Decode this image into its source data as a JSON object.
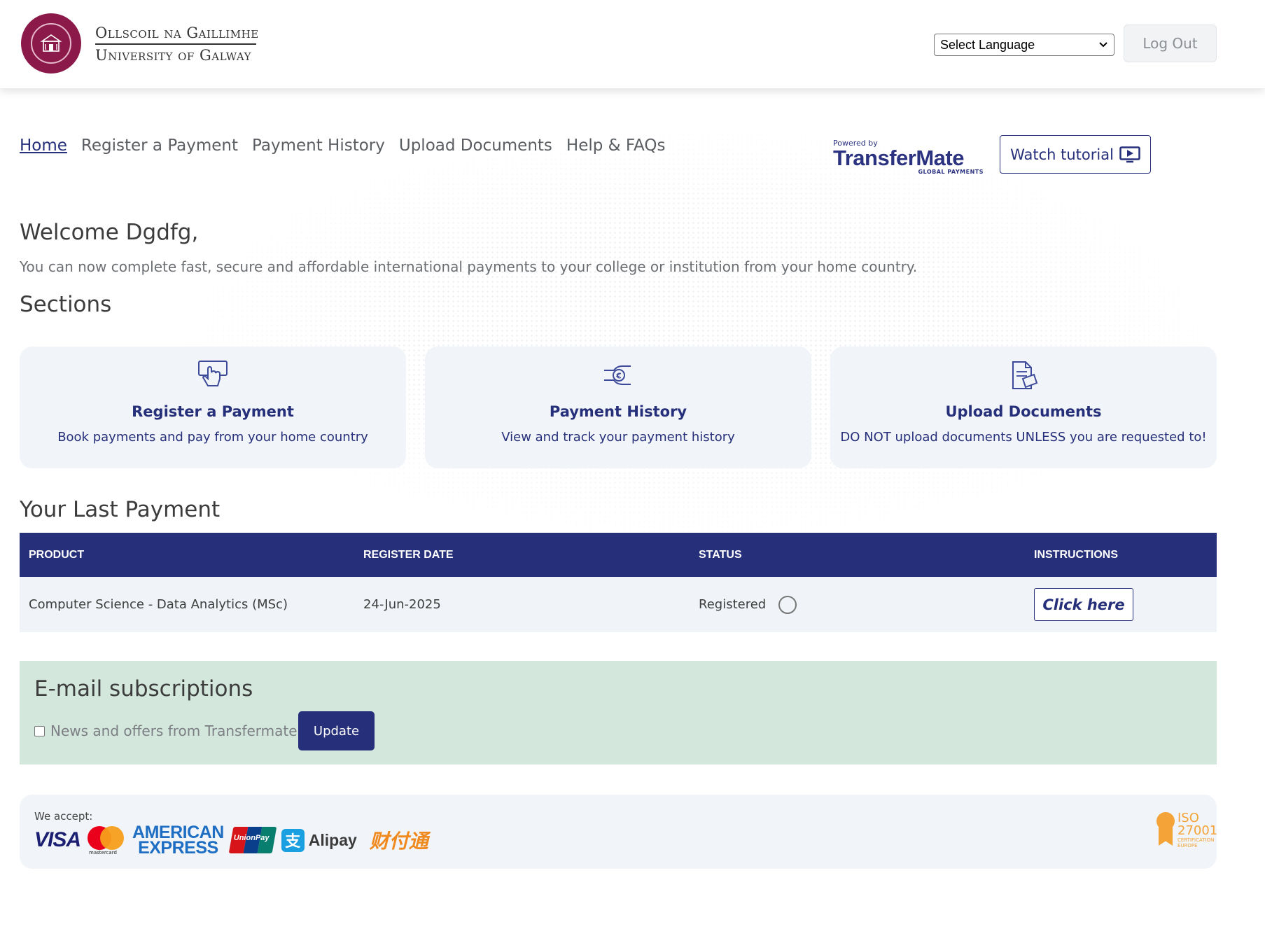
{
  "header": {
    "logo_line1": "Ollscoil na Gaillimhe",
    "logo_line2": "University of Galway",
    "language_select": "Select Language",
    "logout_label": "Log Out"
  },
  "nav": {
    "items": [
      {
        "label": "Home",
        "active": true
      },
      {
        "label": "Register a Payment"
      },
      {
        "label": "Payment History"
      },
      {
        "label": "Upload Documents"
      },
      {
        "label": "Help & FAQs"
      }
    ],
    "powered_by": "Powered by",
    "brand": "TransferMate",
    "brand_tag": "GLOBAL PAYMENTS",
    "watch_tutorial": "Watch tutorial"
  },
  "main": {
    "welcome": "Welcome Dgdfg,",
    "intro": "You can now complete fast, secure and affordable international payments to your college or institution from your home country.",
    "sections_title": "Sections",
    "cards": [
      {
        "icon": "hand-pointer-icon",
        "title": "Register a Payment",
        "desc": "Book payments and pay from your home country"
      },
      {
        "icon": "hand-coin-icon",
        "title": "Payment History",
        "desc": "View and track your payment history"
      },
      {
        "icon": "documents-icon",
        "title": "Upload Documents",
        "desc": "DO NOT upload documents UNLESS you are requested to!"
      }
    ]
  },
  "last_payment": {
    "title": "Your Last Payment",
    "columns": [
      "PRODUCT",
      "REGISTER DATE",
      "STATUS",
      "INSTRUCTIONS"
    ],
    "row": {
      "product": "Computer Science - Data Analytics (MSc)",
      "register_date": "24-Jun-2025",
      "status": "Registered",
      "instructions_button": "Click here"
    }
  },
  "email": {
    "title": "E-mail subscriptions",
    "checkbox_label": "News and offers from Transfermate",
    "checked": false,
    "update_label": "Update"
  },
  "footer": {
    "we_accept": "We accept:",
    "visa": "VISA",
    "mastercard": "mastercard",
    "amex_line1": "AMERICAN",
    "amex_line2": "EXPRESS",
    "unionpay": "UnionPay",
    "alipay": "Alipay",
    "tenpay": "财付通",
    "iso_line1": "ISO",
    "iso_line2": "27001",
    "iso_line3": "CERTIFICATION",
    "iso_line4": "EUROPE"
  },
  "colors": {
    "primary": "#262f7a",
    "university_red": "#8b1a4a",
    "card_bg": "#f1f4f8",
    "email_bg": "#d3e7dd"
  }
}
